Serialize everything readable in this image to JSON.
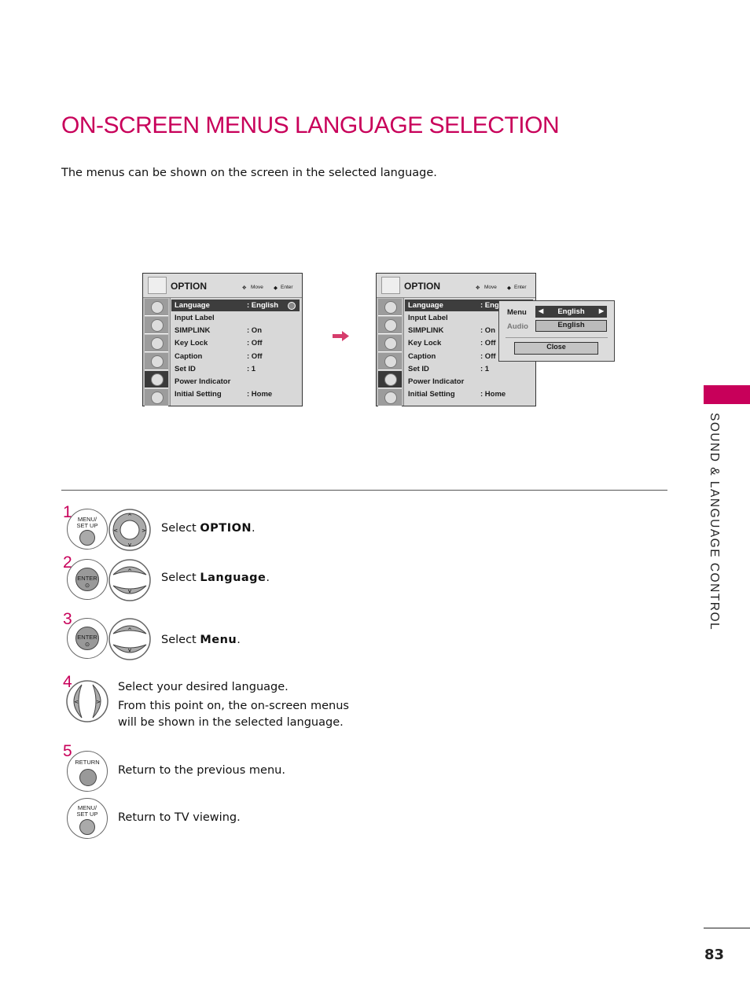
{
  "page": {
    "title": "ON-SCREEN MENUS LANGUAGE SELECTION",
    "intro": "The menus can be shown on the screen in the selected language.",
    "section_tab": "SOUND & LANGUAGE CONTROL",
    "page_number": "83",
    "accent_color": "#c8005a"
  },
  "osd_before": {
    "header_title": "OPTION",
    "hint_move": "Move",
    "hint_enter": "Enter",
    "rows": [
      {
        "label": "Language",
        "value": ": English"
      },
      {
        "label": "Input Label",
        "value": ""
      },
      {
        "label": "SIMPLINK",
        "value": ": On"
      },
      {
        "label": "Key Lock",
        "value": ": Off"
      },
      {
        "label": "Caption",
        "value": ": Off"
      },
      {
        "label": "Set ID",
        "value": ": 1"
      },
      {
        "label": "Power Indicator",
        "value": ""
      },
      {
        "label": "Initial Setting",
        "value": ": Home"
      }
    ]
  },
  "osd_after": {
    "header_title": "OPTION",
    "hint_move": "Move",
    "hint_enter": "Enter",
    "rows": [
      {
        "label": "Language",
        "value": ": Eng"
      },
      {
        "label": "Input Label",
        "value": ""
      },
      {
        "label": "SIMPLINK",
        "value": ": On"
      },
      {
        "label": "Key Lock",
        "value": ": Off"
      },
      {
        "label": "Caption",
        "value": ": Off"
      },
      {
        "label": "Set ID",
        "value": ": 1"
      },
      {
        "label": "Power Indicator",
        "value": ""
      },
      {
        "label": "Initial Setting",
        "value": ": Home"
      }
    ],
    "popup": {
      "menu_label": "Menu",
      "menu_value": "English",
      "audio_label": "Audio",
      "audio_value": "English",
      "close_label": "Close"
    }
  },
  "steps": [
    {
      "num": "1",
      "button": "MENU/\nSET UP",
      "button_l1": "MENU/",
      "button_l2": "SET UP",
      "text_prefix": "Select ",
      "text_bold": "OPTION",
      "text_suffix": "."
    },
    {
      "num": "2",
      "button": "ENTER",
      "text_prefix": "Select ",
      "text_bold": "Language",
      "text_suffix": "."
    },
    {
      "num": "3",
      "button": "ENTER",
      "text_prefix": "Select ",
      "text_bold": "Menu",
      "text_suffix": "."
    },
    {
      "num": "4",
      "lines": [
        "Select your desired language.",
        "From this point on, the on-screen menus",
        "will be shown in the selected language."
      ]
    },
    {
      "num": "5",
      "button": "RETURN",
      "text": "Return to the previous menu."
    },
    {
      "button_l1": "MENU/",
      "button_l2": "SET UP",
      "text": "Return to TV viewing."
    }
  ]
}
